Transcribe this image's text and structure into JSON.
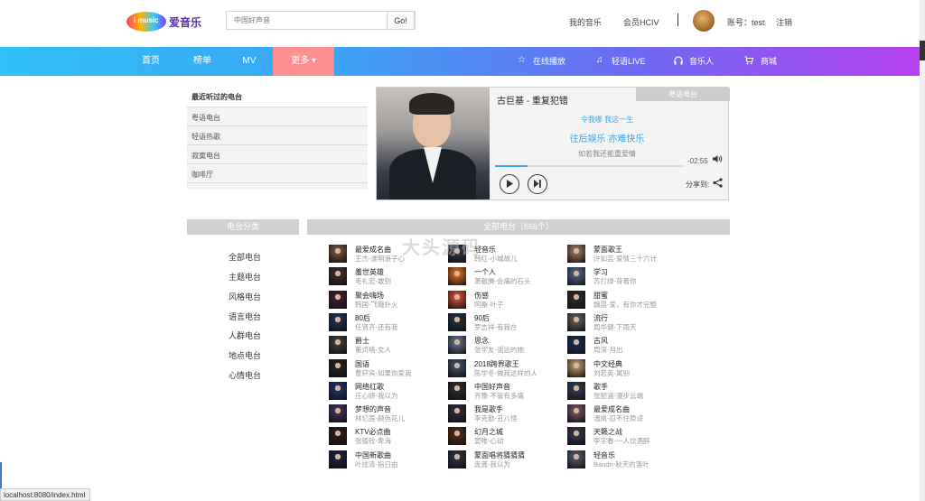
{
  "header": {
    "brand": "爱音乐",
    "logo_text": "i music",
    "search_placeholder": "中国好声音",
    "search_button": "Go!",
    "my_music": "我的音乐",
    "vip_center": "会员HCIV",
    "account_label": "账号：test",
    "logout": "注销"
  },
  "nav": {
    "items": [
      "首页",
      "榜单",
      "MV",
      "更多 ▾"
    ],
    "right": [
      {
        "icon": "star-icon",
        "glyph": "☆",
        "label": "在线播放"
      },
      {
        "icon": "music-note-icon",
        "glyph": "♫",
        "label": "轻语LIVE"
      },
      {
        "icon": "headphones-icon",
        "glyph": "🎧",
        "label": "音乐人"
      },
      {
        "icon": "cart-icon",
        "glyph": "🛒",
        "label": "商城"
      }
    ]
  },
  "recent": {
    "title": "最近听过的电台",
    "items": [
      "粤语电台",
      "轻语热歌",
      "寂寞电台",
      "咖啡厅"
    ]
  },
  "player": {
    "song": "古巨基 - 重复犯错",
    "tag": "粤语电台",
    "lyrics": [
      "令我哪 我这一生",
      "往后娱乐 亦难快乐",
      "如若我还能重爱情"
    ],
    "time": "-02:55",
    "share": "分享到:",
    "progress": 0.17,
    "accent": "#39a6e9"
  },
  "categories": {
    "header": "电台分类",
    "items": [
      "全部电台",
      "主题电台",
      "风格电台",
      "语言电台",
      "人群电台",
      "地点电台",
      "心情电台"
    ]
  },
  "stations": {
    "header": "全部电台（666个）",
    "items": [
      {
        "name": "最爱成名曲",
        "sub": "王杰-谁明浪子心"
      },
      {
        "name": "轻音乐",
        "sub": "韩红-小城故儿"
      },
      {
        "name": "蒙面歌王",
        "sub": "许如芸-爱情三十六计"
      },
      {
        "name": "羞世英雄",
        "sub": "毛礼宏-敢别"
      },
      {
        "name": "一个人",
        "sub": "萧敬腾-会痛的石头"
      },
      {
        "name": "学习",
        "sub": "苏打绿-背着你"
      },
      {
        "name": "聚会嗨场",
        "sub": "韩国-飞蛾扑火"
      },
      {
        "name": "伤感",
        "sub": "阿桑-叶子"
      },
      {
        "name": "甜蜜",
        "sub": "魏晨-爱，有你才完整"
      },
      {
        "name": "80后",
        "sub": "任贤齐-还有我"
      },
      {
        "name": "90后",
        "sub": "罗志祥-有我在"
      },
      {
        "name": "流行",
        "sub": "周华健-下雨天"
      },
      {
        "name": "爵士",
        "sub": "董贞格-女人"
      },
      {
        "name": "思念",
        "sub": "张学友-谣远的她"
      },
      {
        "name": "古风",
        "sub": "周深-月出"
      },
      {
        "name": "国语",
        "sub": "曹轩宾-如果你爱我"
      },
      {
        "name": "2018跨界歌王",
        "sub": "陈学冬-做我这样的人"
      },
      {
        "name": "中文经典",
        "sub": "刘若英-寓别"
      },
      {
        "name": "网络红歌",
        "sub": "庄心妍-我以为"
      },
      {
        "name": "中国好声音",
        "sub": "齐豫-不管有多痛"
      },
      {
        "name": "歌手",
        "sub": "张韶涵-漫步云端"
      },
      {
        "name": "梦想的声音",
        "sub": "林忆莲-颜色花儿"
      },
      {
        "name": "我是歌手",
        "sub": "李克勤-丑八怪"
      },
      {
        "name": "最爱成名曲",
        "sub": "温岚-忍不住原谅"
      },
      {
        "name": "KTV必点曲",
        "sub": "张德铨-卑海"
      },
      {
        "name": "幻月之城",
        "sub": "窦唯-心动"
      },
      {
        "name": "天籁之战",
        "sub": "李宇春-一人饮酒醉"
      },
      {
        "name": "中国新歌曲",
        "sub": "叶炫清-指日由"
      },
      {
        "name": "蒙面唱将猜猜猜",
        "sub": "庞龚-我以为"
      },
      {
        "name": "轻音乐",
        "sub": "Bandri-秋天的落叶"
      }
    ]
  },
  "watermark": "大头源码",
  "status_url": "localhost:8080/index.html"
}
